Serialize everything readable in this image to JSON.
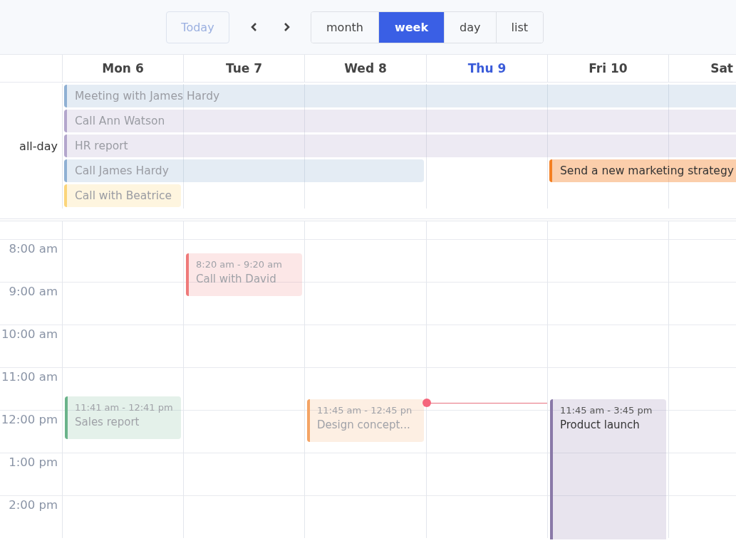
{
  "toolbar": {
    "today_button": {
      "label": "Today",
      "disabled": true
    },
    "views": [
      {
        "label": "month",
        "selected": false
      },
      {
        "label": "week",
        "selected": true
      },
      {
        "label": "day",
        "selected": false
      },
      {
        "label": "list",
        "selected": false
      }
    ]
  },
  "days": [
    {
      "label": "Mon 6",
      "today": false,
      "events": [
        {
          "time": "11:41 am - 12:41 pm",
          "title": "Sales report",
          "color": "#6ab38a",
          "past": true
        }
      ]
    },
    {
      "label": "Tue 7",
      "today": false,
      "events": [
        {
          "time": "8:20 am - 9:20 am",
          "title": "Call with David",
          "color": "#ef7a7a",
          "past": true
        }
      ]
    },
    {
      "label": "Wed 8",
      "today": false,
      "events": [
        {
          "time": "11:45 am - 12:45 pn",
          "title": "Design concept...",
          "color": "#f4a465",
          "past": true
        }
      ]
    },
    {
      "label": "Thu 9",
      "today": true,
      "now_line": true
    },
    {
      "label": "Fri 10",
      "today": false,
      "events": [
        {
          "time": "11:45 am - 3:45 pm",
          "title": "Product launch",
          "color": "#8a79a8",
          "past": false
        }
      ]
    },
    {
      "label": "Sat",
      "today": false
    }
  ],
  "all_day": {
    "label": "all-day",
    "lanes": [
      [
        {
          "kind": "start",
          "title": "Meeting with James Hardy",
          "color": "#8fb0d3",
          "past": true
        },
        {
          "kind": "continue"
        },
        {
          "kind": "continue"
        },
        {
          "kind": "continue"
        },
        {
          "kind": "continue"
        },
        {
          "kind": "continue"
        }
      ],
      [
        {
          "kind": "start",
          "title": "Call Ann Watson",
          "color": "#b3a6cc",
          "past": true
        },
        {
          "kind": "continue"
        },
        {
          "kind": "continue"
        },
        {
          "kind": "continue"
        },
        {
          "kind": "continue"
        },
        {
          "kind": "continue"
        }
      ],
      [
        {
          "kind": "start",
          "title": "HR report",
          "color": "#b3a6cc",
          "past": true
        },
        {
          "kind": "continue"
        },
        {
          "kind": "continue"
        },
        {
          "kind": "continue"
        },
        {
          "kind": "continue"
        },
        {
          "kind": "continue"
        }
      ],
      [
        {
          "kind": "start",
          "title": "Call James Hardy",
          "color": "#8fb0d3",
          "past": true
        },
        {
          "kind": "continue"
        },
        {
          "kind": "continue"
        },
        {
          "kind": "empty"
        },
        {
          "kind": "start",
          "title": "Send a new marketing strategy",
          "color": "#f47f21",
          "past": false
        },
        {
          "kind": "continue"
        }
      ],
      [
        {
          "kind": "start",
          "title": "Call with Beatrice",
          "color": "#fbd57a",
          "past": true
        },
        {
          "kind": "empty"
        },
        {
          "kind": "empty"
        },
        {
          "kind": "empty"
        },
        {
          "kind": "empty"
        },
        {
          "kind": "empty"
        }
      ]
    ]
  },
  "time_grid": {
    "hours": [
      "8:00 am",
      "9:00 am",
      "10:00 am",
      "11:00 am",
      "12:00 pm",
      "1:00 pm",
      "2:00 pm"
    ]
  }
}
